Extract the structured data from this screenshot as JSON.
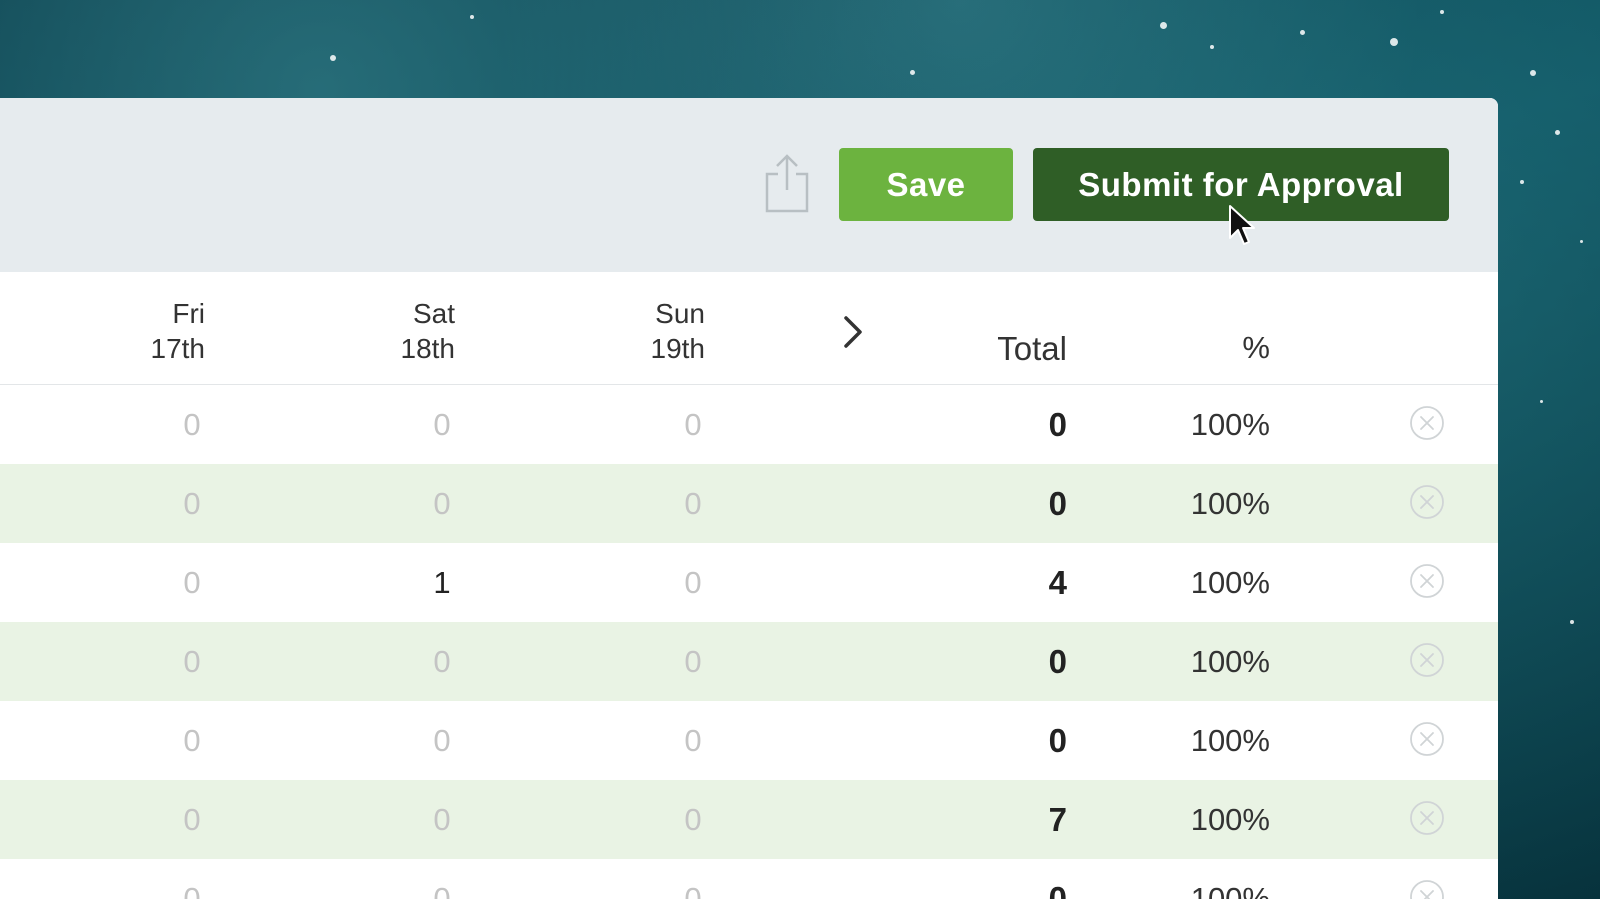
{
  "toolbar": {
    "save_label": "Save",
    "submit_label": "Submit for Approval"
  },
  "columns": {
    "days": [
      {
        "dow": "Fri",
        "date": "17th"
      },
      {
        "dow": "Sat",
        "date": "18th"
      },
      {
        "dow": "Sun",
        "date": "19th"
      }
    ],
    "total": "Total",
    "percent": "%"
  },
  "rows": [
    {
      "days": [
        "0",
        "0",
        "0"
      ],
      "total": "0",
      "percent": "100%"
    },
    {
      "days": [
        "0",
        "0",
        "0"
      ],
      "total": "0",
      "percent": "100%"
    },
    {
      "days": [
        "0",
        "1",
        "0"
      ],
      "total": "4",
      "percent": "100%"
    },
    {
      "days": [
        "0",
        "0",
        "0"
      ],
      "total": "0",
      "percent": "100%"
    },
    {
      "days": [
        "0",
        "0",
        "0"
      ],
      "total": "0",
      "percent": "100%"
    },
    {
      "days": [
        "0",
        "0",
        "0"
      ],
      "total": "7",
      "percent": "100%"
    },
    {
      "days": [
        "0",
        "0",
        "0"
      ],
      "total": "0",
      "percent": "100%"
    }
  ],
  "icons": {
    "share": "share-icon",
    "next": "chevron-right-icon",
    "remove": "close-circle-icon"
  },
  "colors": {
    "save_button": "#6cb33f",
    "submit_button": "#2f5e26",
    "alt_row": "#e9f3e4",
    "toolbar_bg": "#e6ebee"
  }
}
